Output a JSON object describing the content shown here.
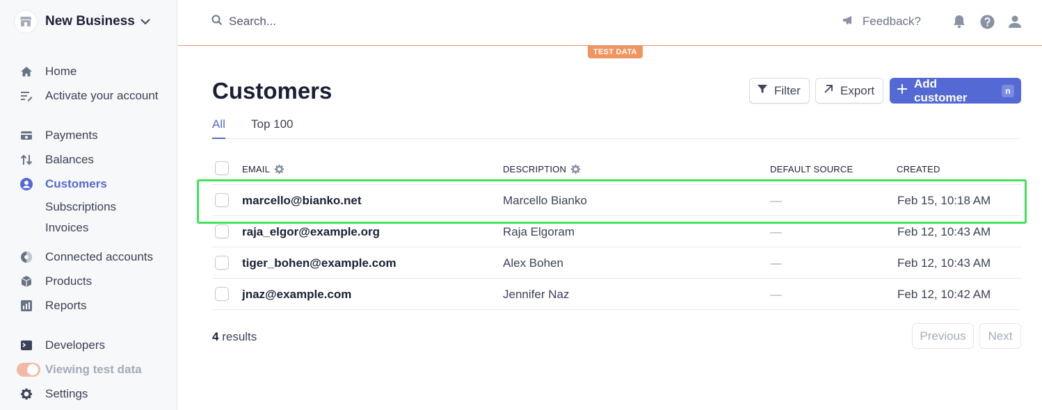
{
  "business": {
    "name": "New Business"
  },
  "sidebar": {
    "items": [
      {
        "label": "Home",
        "icon": "home-icon"
      },
      {
        "label": "Activate your account",
        "icon": "checklist-icon"
      },
      {
        "label": "Payments",
        "icon": "payments-icon"
      },
      {
        "label": "Balances",
        "icon": "balances-icon"
      },
      {
        "label": "Customers",
        "icon": "customers-icon",
        "active": true
      },
      {
        "label": "Connected accounts",
        "icon": "connected-accounts-icon"
      },
      {
        "label": "Products",
        "icon": "box-icon"
      },
      {
        "label": "Reports",
        "icon": "reports-icon"
      },
      {
        "label": "Developers",
        "icon": "terminal-icon"
      },
      {
        "label": "Viewing test data",
        "icon": "toggle"
      },
      {
        "label": "Settings",
        "icon": "gear-icon"
      }
    ],
    "subitems": [
      "Subscriptions",
      "Invoices"
    ]
  },
  "header": {
    "search_placeholder": "Search...",
    "feedback_label": "Feedback?",
    "test_badge": "TEST DATA"
  },
  "page": {
    "title": "Customers",
    "filter_label": "Filter",
    "export_label": "Export",
    "add_label": "Add customer",
    "add_shortcut": "n",
    "tabs": [
      "All",
      "Top 100"
    ],
    "active_tab": "All"
  },
  "table": {
    "columns": [
      "EMAIL",
      "DESCRIPTION",
      "DEFAULT SOURCE",
      "CREATED"
    ],
    "rows": [
      {
        "email": "marcello@bianko.net",
        "description": "Marcello Bianko",
        "source": "—",
        "created": "Feb 15, 10:18 AM"
      },
      {
        "email": "raja_elgor@example.org",
        "description": "Raja Elgoram",
        "source": "—",
        "created": "Feb 12, 10:43 AM"
      },
      {
        "email": "tiger_bohen@example.com",
        "description": "Alex Bohen",
        "source": "—",
        "created": "Feb 12, 10:43 AM"
      },
      {
        "email": "jnaz@example.com",
        "description": "Jennifer Naz",
        "source": "—",
        "created": "Feb 12, 10:42 AM"
      }
    ]
  },
  "footer": {
    "results_count": "4",
    "results_label": "results",
    "previous_label": "Previous",
    "next_label": "Next"
  },
  "colors": {
    "accent": "#5469d4",
    "test_orange": "#f0955f",
    "highlight_green": "#3ee35a"
  }
}
